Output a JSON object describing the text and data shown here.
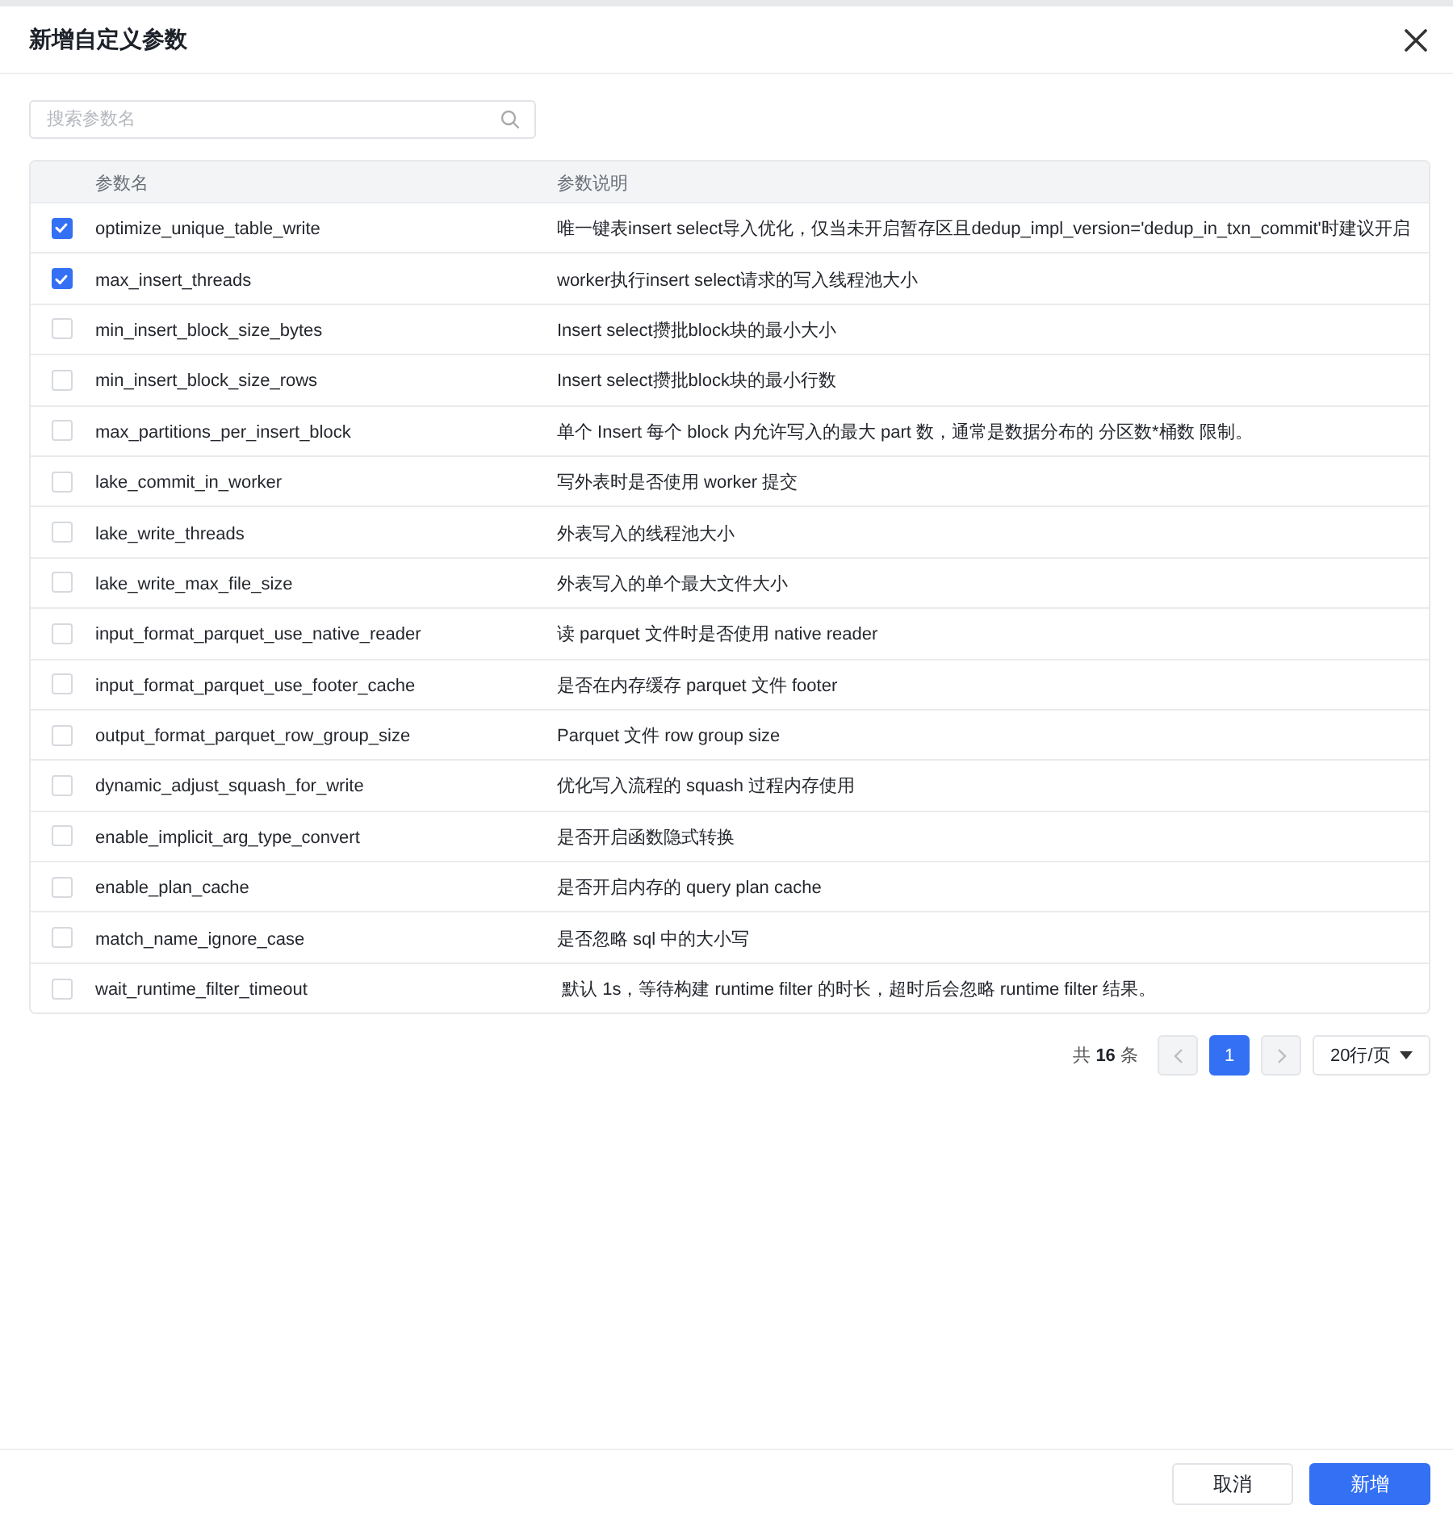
{
  "dialog": {
    "title": "新增自定义参数"
  },
  "search": {
    "placeholder": "搜索参数名"
  },
  "table": {
    "columns": [
      "参数名",
      "参数说明"
    ],
    "rows": [
      {
        "name": "optimize_unique_table_write",
        "description": "唯一键表insert select导入优化，仅当未开启暂存区且dedup_impl_version='dedup_in_txn_commit'时建议开启",
        "checked": true
      },
      {
        "name": "max_insert_threads",
        "description": "worker执行insert select请求的写入线程池大小",
        "checked": true
      },
      {
        "name": "min_insert_block_size_bytes",
        "description": "Insert select攒批block块的最小大小",
        "checked": false
      },
      {
        "name": "min_insert_block_size_rows",
        "description": "Insert select攒批block块的最小行数",
        "checked": false
      },
      {
        "name": "max_partitions_per_insert_block",
        "description": "单个 Insert 每个 block 内允许写入的最大 part 数，通常是数据分布的 分区数*桶数 限制。",
        "checked": false
      },
      {
        "name": "lake_commit_in_worker",
        "description": "写外表时是否使用 worker 提交",
        "checked": false
      },
      {
        "name": "lake_write_threads",
        "description": "外表写入的线程池大小",
        "checked": false
      },
      {
        "name": "lake_write_max_file_size",
        "description": "外表写入的单个最大文件大小",
        "checked": false
      },
      {
        "name": "input_format_parquet_use_native_reader",
        "description": "读 parquet 文件时是否使用 native reader",
        "checked": false
      },
      {
        "name": "input_format_parquet_use_footer_cache",
        "description": "是否在内存缓存 parquet 文件 footer",
        "checked": false
      },
      {
        "name": "output_format_parquet_row_group_size",
        "description": "Parquet 文件 row group size",
        "checked": false
      },
      {
        "name": "dynamic_adjust_squash_for_write",
        "description": "优化写入流程的 squash 过程内存使用",
        "checked": false
      },
      {
        "name": "enable_implicit_arg_type_convert",
        "description": "是否开启函数隐式转换",
        "checked": false
      },
      {
        "name": "enable_plan_cache",
        "description": "是否开启内存的 query plan cache",
        "checked": false
      },
      {
        "name": "match_name_ignore_case",
        "description": "是否忽略 sql 中的大小写",
        "checked": false
      },
      {
        "name": "wait_runtime_filter_timeout",
        "description": " 默认 1s，等待构建 runtime filter 的时长，超时后会忽略 runtime filter 结果。",
        "checked": false
      }
    ]
  },
  "pagination": {
    "total": "共 **16** 条",
    "prev": {
      "disabled": true
    },
    "pages": [
      {
        "label": "1",
        "selected": true
      }
    ],
    "next": {
      "disabled": true
    },
    "page_size": "20行/页"
  },
  "footer": {
    "buttons": [
      {
        "label": "取消",
        "kind": "secondary"
      },
      {
        "label": "新增",
        "kind": "primary"
      }
    ]
  }
}
